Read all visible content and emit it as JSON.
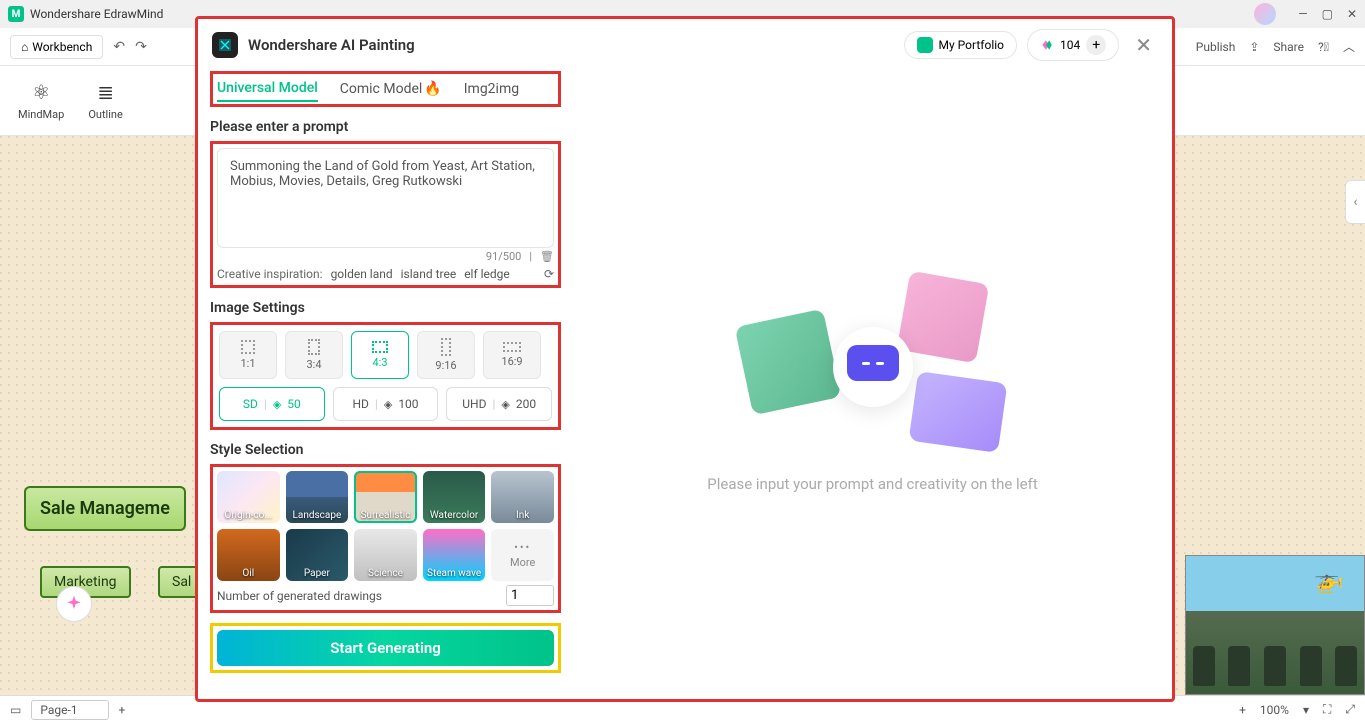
{
  "app": {
    "title": "Wondershare EdrawMind"
  },
  "toolbar": {
    "workbench": "Workbench",
    "publish": "Publish",
    "share": "Share"
  },
  "ribbon": {
    "mindmap": "MindMap",
    "outline": "Outline"
  },
  "mindmap": {
    "root": "Sale Manageme",
    "node1": "Marketing",
    "node2": "Sal"
  },
  "statusbar": {
    "page": "Page-1",
    "zoom": "100%"
  },
  "modal": {
    "title": "Wondershare AI Painting",
    "portfolio": "My Portfolio",
    "credits": "104",
    "tabs": {
      "universal": "Universal Model",
      "comic": "Comic Model",
      "img2img": "Img2img"
    },
    "prompt": {
      "title": "Please enter a prompt",
      "text": "Summoning the Land of Gold from Yeast, Art Station, Mobius, Movies, Details, Greg Rutkowski",
      "counter": "91/500",
      "insp_label": "Creative inspiration:",
      "tags": {
        "t1": "golden land",
        "t2": "island tree",
        "t3": "elf ledge"
      }
    },
    "settings": {
      "title": "Image Settings",
      "ratios": {
        "r1": "1:1",
        "r2": "3:4",
        "r3": "4:3",
        "r4": "9:16",
        "r5": "16:9"
      },
      "quality": {
        "sd": "SD",
        "sd_cost": "50",
        "hd": "HD",
        "hd_cost": "100",
        "uhd": "UHD",
        "uhd_cost": "200"
      }
    },
    "styles": {
      "title": "Style Selection",
      "items": {
        "s1": "Origin-co...",
        "s2": "Landscape",
        "s3": "Surrealistic",
        "s4": "Watercolor",
        "s5": "Ink",
        "s6": "Oil",
        "s7": "Paper",
        "s8": "Science",
        "s9": "Steam wave"
      },
      "more": "More",
      "numlabel": "Number of generated drawings",
      "numvalue": "1"
    },
    "generate": "Start Generating",
    "placeholder": "Please input your prompt and creativity on the left"
  }
}
